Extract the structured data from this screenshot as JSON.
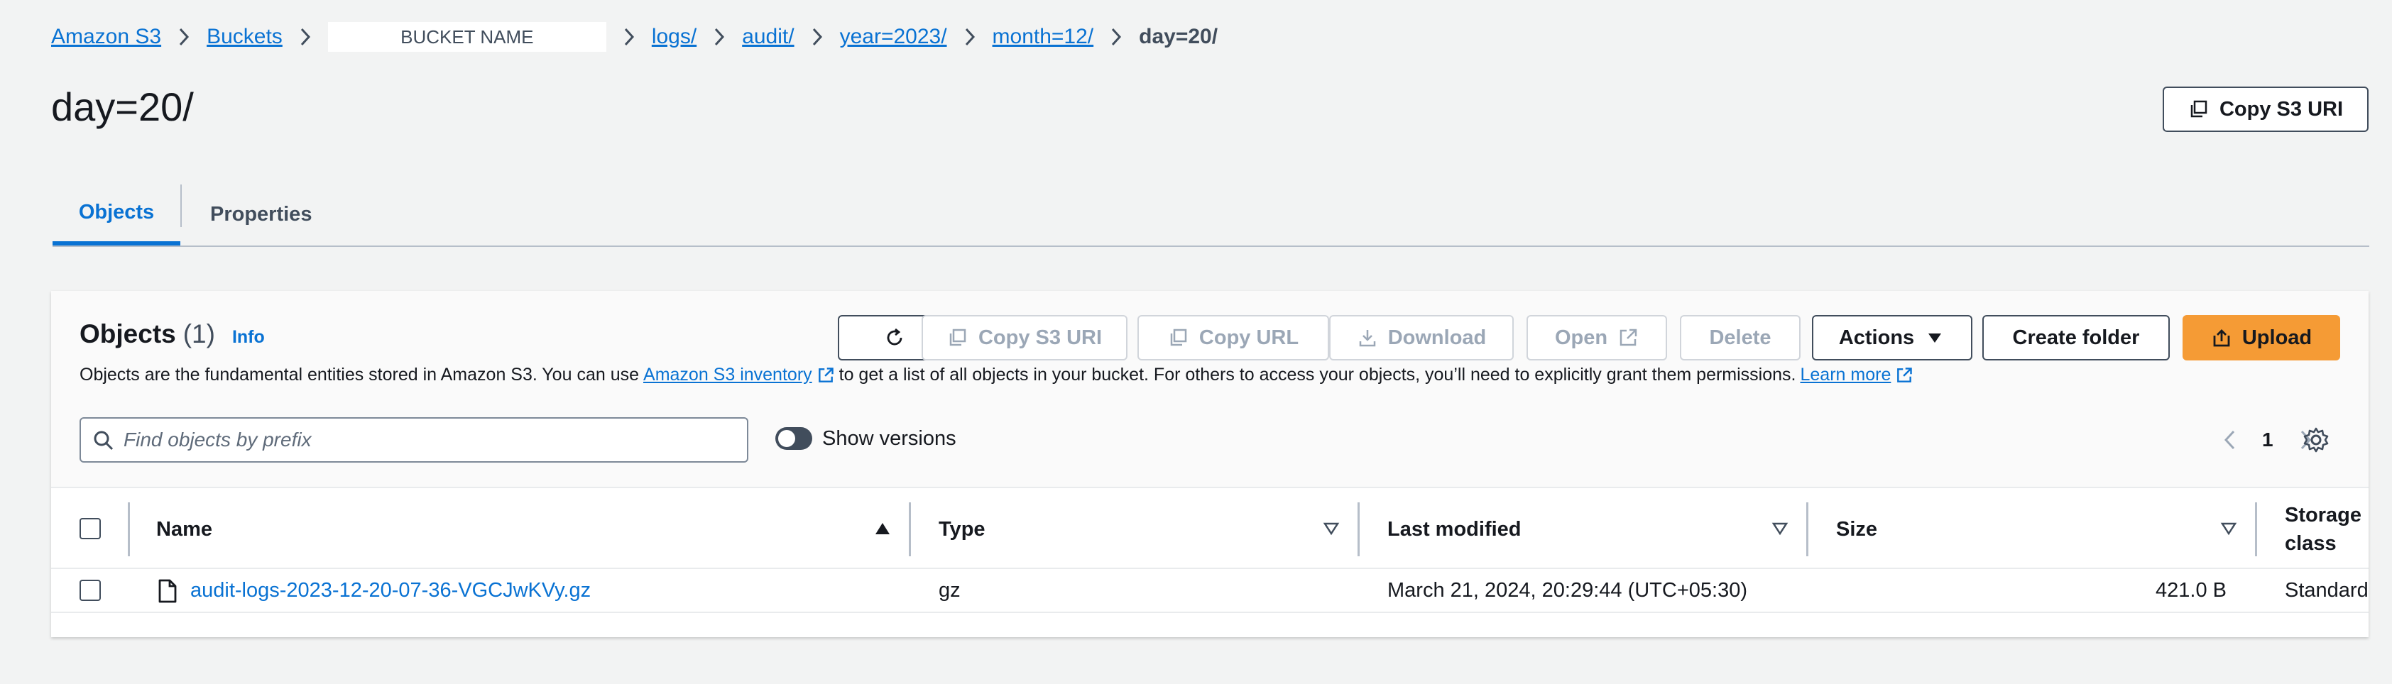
{
  "breadcrumb": {
    "items": [
      {
        "label": "Amazon S3"
      },
      {
        "label": "Buckets"
      },
      {
        "label": "BUCKET NAME"
      },
      {
        "label": "logs/"
      },
      {
        "label": "audit/"
      },
      {
        "label": "year=2023/"
      },
      {
        "label": "month=12/"
      }
    ],
    "current": "day=20/"
  },
  "page": {
    "title": "day=20/",
    "copy_uri_label": "Copy S3 URI"
  },
  "tabs": [
    {
      "label": "Objects",
      "active": true
    },
    {
      "label": "Properties",
      "active": false
    }
  ],
  "objects_panel": {
    "title": "Objects",
    "count": "(1)",
    "info_label": "Info",
    "description_prefix": "Objects are the fundamental entities stored in Amazon S3. You can use",
    "inventory_link": "Amazon S3 inventory",
    "description_middle": "to get a list of all objects in your bucket. For others to access your objects, you’ll need to explicitly grant them permissions.",
    "learn_more_link": "Learn more",
    "toolbar": {
      "copy_uri": "Copy S3 URI",
      "copy_url": "Copy URL",
      "download": "Download",
      "open": "Open",
      "delete": "Delete",
      "actions": "Actions",
      "create_folder": "Create folder",
      "upload": "Upload"
    },
    "search": {
      "placeholder": "Find objects by prefix",
      "value": ""
    },
    "show_versions_label": "Show versions",
    "show_versions_on": false,
    "pagination": {
      "current_page": "1"
    }
  },
  "table": {
    "columns": {
      "name": "Name",
      "type": "Type",
      "last_modified": "Last modified",
      "size": "Size",
      "storage_class_line1": "Storage",
      "storage_class_line2": "class"
    },
    "rows": [
      {
        "name": "audit-logs-2023-12-20-07-36-VGCJwKVy.gz",
        "type": "gz",
        "last_modified": "March 21, 2024, 20:29:44 (UTC+05:30)",
        "size": "421.0 B",
        "storage_class": "Standard"
      }
    ]
  },
  "colors": {
    "link": "#0972d3",
    "primary_button": "#f59b35",
    "text": "#16191f",
    "background": "#f2f3f3"
  }
}
